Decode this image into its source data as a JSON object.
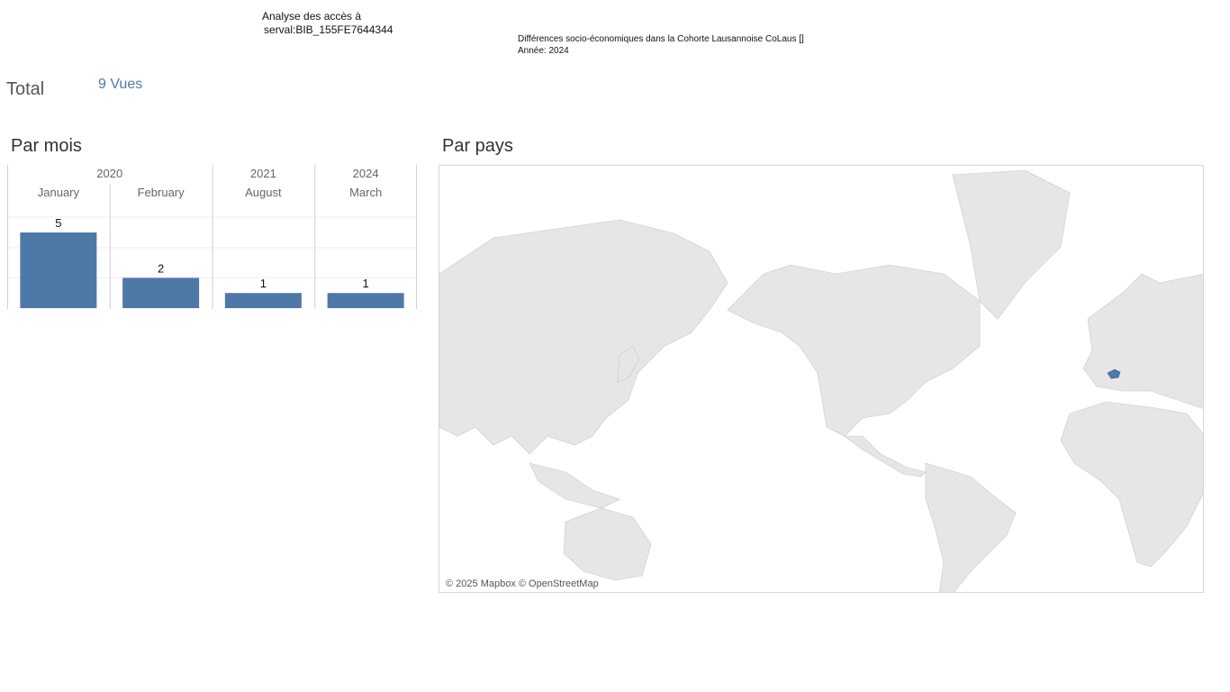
{
  "header": {
    "title_line1": "Analyse des accès à",
    "title_line2": "serval:BIB_155FE7644344",
    "subtitle_line1": "Différences socio-économiques dans la Cohorte Lausannoise CoLaus []",
    "subtitle_line2": "Année: 2024"
  },
  "total": {
    "label": "Total",
    "value": "9 Vues"
  },
  "sections": {
    "by_month": "Par mois",
    "by_country": "Par pays"
  },
  "chart_data": {
    "type": "bar",
    "year_groups": [
      {
        "year": "2020",
        "months": [
          "January",
          "February"
        ]
      },
      {
        "year": "2021",
        "months": [
          "August"
        ]
      },
      {
        "year": "2024",
        "months": [
          "March"
        ]
      }
    ],
    "categories": [
      "January",
      "February",
      "August",
      "March"
    ],
    "values": [
      5,
      2,
      1,
      1
    ],
    "ylim": [
      0,
      5
    ],
    "grid": true,
    "bar_color": "#4e79a7"
  },
  "map": {
    "credit": "© 2025 Mapbox © OpenStreetMap",
    "highlighted_country": "Switzerland",
    "highlight_color": "#4e79a7",
    "land_color": "#e6e6e6"
  }
}
